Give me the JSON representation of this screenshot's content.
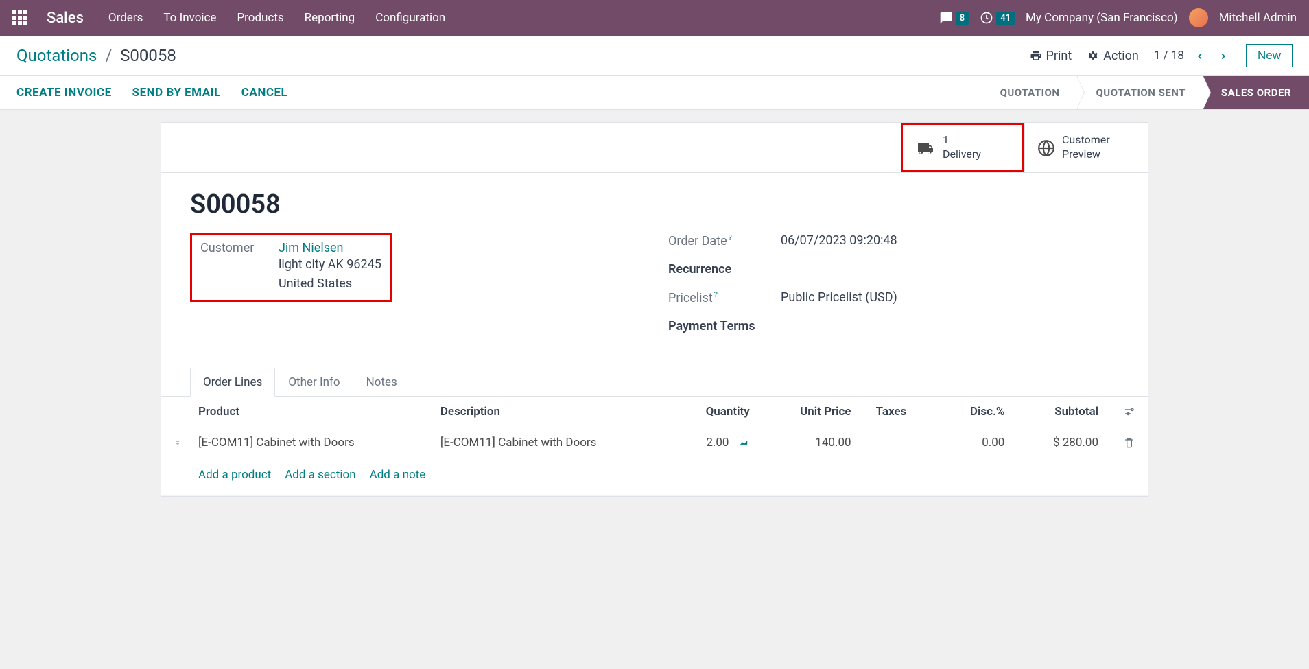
{
  "navbar": {
    "app_name": "Sales",
    "menu": [
      "Orders",
      "To Invoice",
      "Products",
      "Reporting",
      "Configuration"
    ],
    "messages_badge": "8",
    "activities_badge": "41",
    "company": "My Company (San Francisco)",
    "user": "Mitchell Admin"
  },
  "subbar": {
    "breadcrumb_root": "Quotations",
    "breadcrumb_current": "S00058",
    "print": "Print",
    "action": "Action",
    "pager": "1 / 18",
    "new": "New"
  },
  "actionbar": {
    "create_invoice": "CREATE INVOICE",
    "send_email": "SEND BY EMAIL",
    "cancel": "CANCEL",
    "status": [
      "QUOTATION",
      "QUOTATION SENT",
      "SALES ORDER"
    ]
  },
  "stat_buttons": {
    "delivery_count": "1",
    "delivery_label": "Delivery",
    "preview_line1": "Customer",
    "preview_line2": "Preview"
  },
  "form": {
    "title": "S00058",
    "customer_label": "Customer",
    "customer_name": "Jim Nielsen",
    "customer_addr1": "light city AK 96245",
    "customer_addr2": "United States",
    "order_date_label": "Order Date",
    "order_date": "06/07/2023 09:20:48",
    "recurrence_label": "Recurrence",
    "pricelist_label": "Pricelist",
    "pricelist": "Public Pricelist (USD)",
    "payment_terms_label": "Payment Terms"
  },
  "tabs": [
    "Order Lines",
    "Other Info",
    "Notes"
  ],
  "table": {
    "headers": {
      "product": "Product",
      "description": "Description",
      "quantity": "Quantity",
      "unit_price": "Unit Price",
      "taxes": "Taxes",
      "disc": "Disc.%",
      "subtotal": "Subtotal"
    },
    "row": {
      "product": "[E-COM11] Cabinet with Doors",
      "description": "[E-COM11] Cabinet with Doors",
      "quantity": "2.00",
      "unit_price": "140.00",
      "disc": "0.00",
      "subtotal": "$ 280.00"
    },
    "add_product": "Add a product",
    "add_section": "Add a section",
    "add_note": "Add a note"
  }
}
